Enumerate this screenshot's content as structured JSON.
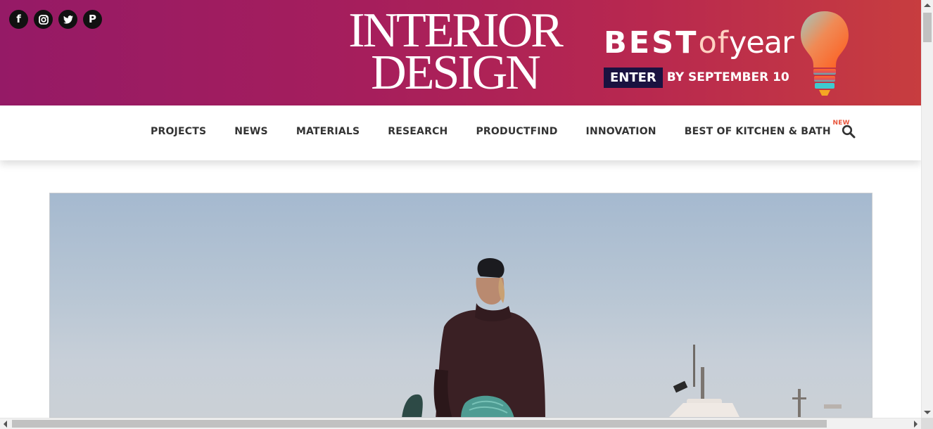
{
  "social": [
    {
      "name": "facebook-icon",
      "glyph": "f"
    },
    {
      "name": "instagram-icon",
      "glyph": ""
    },
    {
      "name": "twitter-icon",
      "glyph": ""
    },
    {
      "name": "pinterest-icon",
      "glyph": "P"
    }
  ],
  "logo": {
    "line1": "INTERIOR",
    "line2": "DESIGN"
  },
  "promo": {
    "best": "BEST",
    "of": "of",
    "year": "year",
    "enter": "ENTER",
    "date": "BY SEPTEMBER 10"
  },
  "nav": {
    "items": [
      "PROJECTS",
      "NEWS",
      "MATERIALS",
      "RESEARCH",
      "PRODUCTFIND",
      "INNOVATION",
      "BEST OF KITCHEN & BATH"
    ],
    "new_badge": "NEW"
  },
  "colors": {
    "banner_start": "#951a66",
    "banner_end": "#c73d3f",
    "enter_bg": "#1a1240",
    "new_badge": "#e8543a"
  }
}
